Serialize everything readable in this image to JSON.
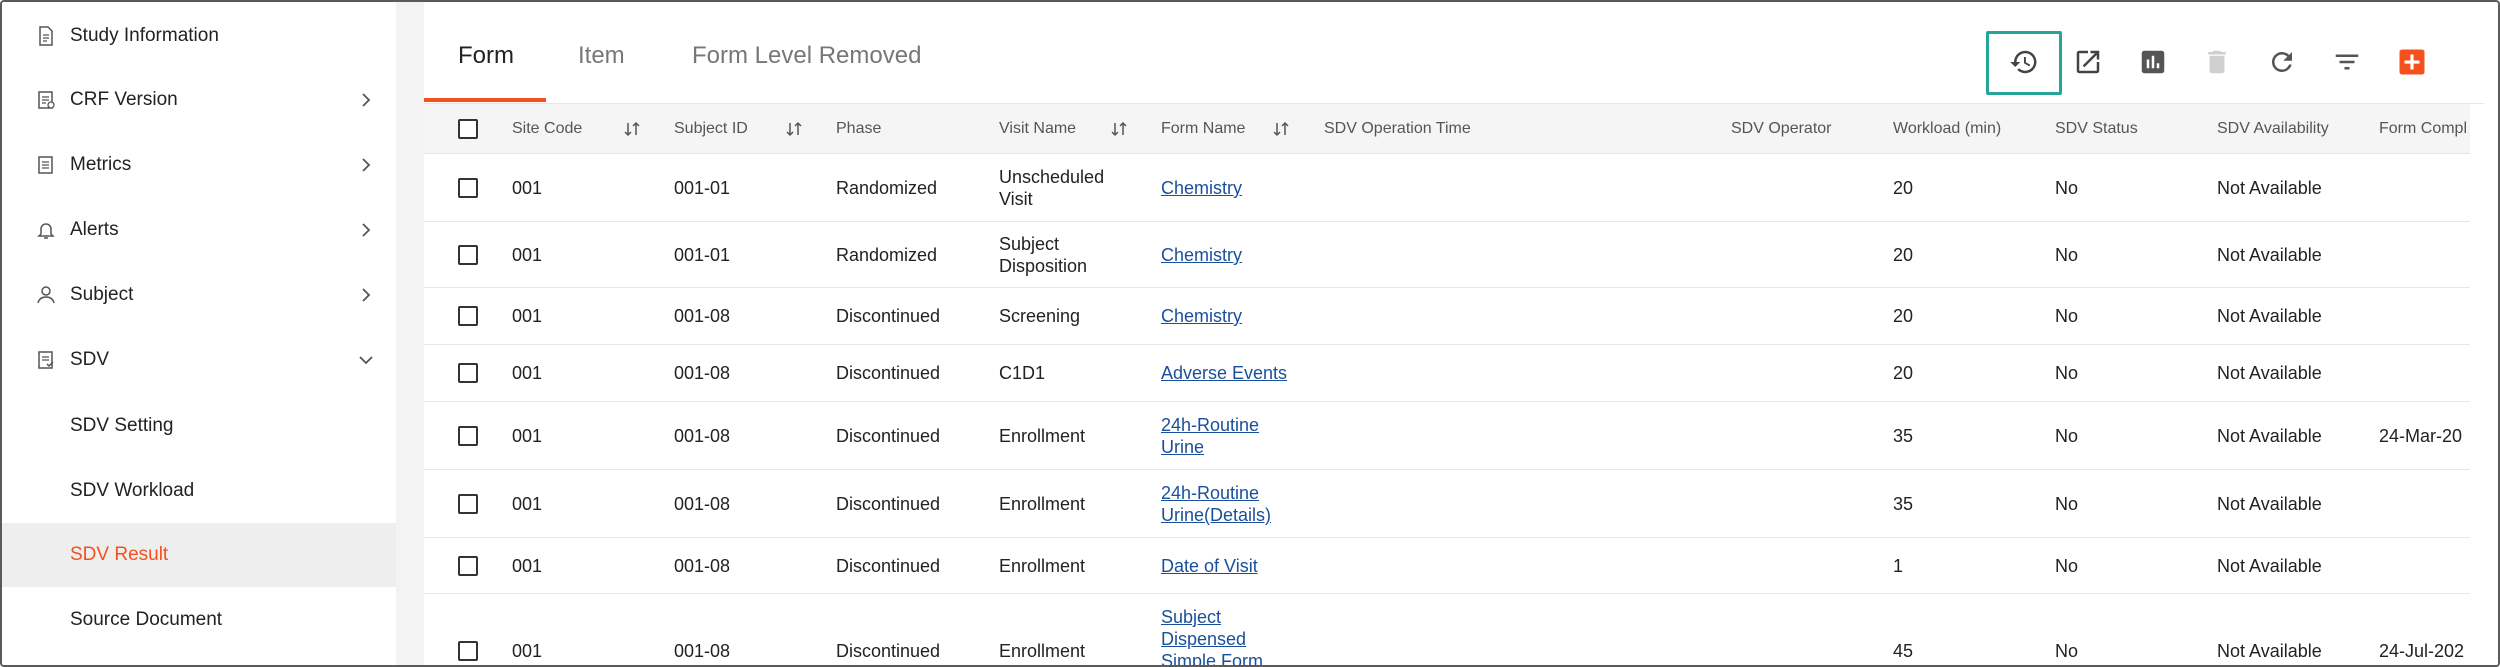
{
  "sidebar": {
    "items": [
      {
        "label": "Study Information",
        "icon": "document-icon",
        "has_chevron": false
      },
      {
        "label": "CRF Version",
        "icon": "form-icon",
        "has_chevron": true
      },
      {
        "label": "Metrics",
        "icon": "metrics-icon",
        "has_chevron": true
      },
      {
        "label": "Alerts",
        "icon": "bell-icon",
        "has_chevron": true
      },
      {
        "label": "Subject",
        "icon": "person-icon",
        "has_chevron": true
      },
      {
        "label": "SDV",
        "icon": "checklist-icon",
        "has_chevron": true,
        "expanded": true
      }
    ],
    "sub_items": [
      {
        "label": "SDV Setting"
      },
      {
        "label": "SDV Workload"
      },
      {
        "label": "SDV Result",
        "active": true
      },
      {
        "label": "Source Document"
      }
    ]
  },
  "tabs": [
    {
      "label": "Form",
      "active": true
    },
    {
      "label": "Item"
    },
    {
      "label": "Form Level Removed"
    }
  ],
  "toolbar": {
    "icons": [
      "history-icon",
      "open-external-icon",
      "bar-chart-icon",
      "delete-icon",
      "refresh-icon",
      "filter-icon",
      "add-icon"
    ],
    "highlighted": "history-icon"
  },
  "table": {
    "headers": [
      "Site Code",
      "Subject ID",
      "Phase",
      "Visit Name",
      "Form Name",
      "SDV Operation Time",
      "SDV Operator",
      "Workload (min)",
      "SDV Status",
      "SDV Availability",
      "Form Compl"
    ],
    "rows": [
      {
        "site": "001",
        "subject": "001-01",
        "phase": "Randomized",
        "visit": "Unscheduled Visit",
        "form": "Chemistry",
        "op_time": "",
        "operator": "",
        "workload": "20",
        "status": "No",
        "availability": "Not Available",
        "form_compl": ""
      },
      {
        "site": "001",
        "subject": "001-01",
        "phase": "Randomized",
        "visit": "Subject Disposition",
        "form": "Chemistry",
        "op_time": "",
        "operator": "",
        "workload": "20",
        "status": "No",
        "availability": "Not Available",
        "form_compl": ""
      },
      {
        "site": "001",
        "subject": "001-08",
        "phase": "Discontinued",
        "visit": "Screening",
        "form": "Chemistry",
        "op_time": "",
        "operator": "",
        "workload": "20",
        "status": "No",
        "availability": "Not Available",
        "form_compl": ""
      },
      {
        "site": "001",
        "subject": "001-08",
        "phase": "Discontinued",
        "visit": "C1D1",
        "form": "Adverse Events",
        "op_time": "",
        "operator": "",
        "workload": "20",
        "status": "No",
        "availability": "Not Available",
        "form_compl": ""
      },
      {
        "site": "001",
        "subject": "001-08",
        "phase": "Discontinued",
        "visit": "Enrollment",
        "form": "24h-Routine Urine",
        "op_time": "",
        "operator": "",
        "workload": "35",
        "status": "No",
        "availability": "Not Available",
        "form_compl": "24-Mar-20"
      },
      {
        "site": "001",
        "subject": "001-08",
        "phase": "Discontinued",
        "visit": "Enrollment",
        "form": "24h-Routine Urine(Details)",
        "op_time": "",
        "operator": "",
        "workload": "35",
        "status": "No",
        "availability": "Not Available",
        "form_compl": ""
      },
      {
        "site": "001",
        "subject": "001-08",
        "phase": "Discontinued",
        "visit": "Enrollment",
        "form": "Date of Visit",
        "op_time": "",
        "operator": "",
        "workload": "1",
        "status": "No",
        "availability": "Not Available",
        "form_compl": ""
      },
      {
        "site": "001",
        "subject": "001-08",
        "phase": "Discontinued",
        "visit": "Enrollment",
        "form": "Subject Dispensed Simple Form",
        "op_time": "",
        "operator": "",
        "workload": "45",
        "status": "No",
        "availability": "Not Available",
        "form_compl": "24-Jul-202"
      }
    ]
  },
  "colors": {
    "accent": "#f4511e",
    "highlight": "#26a69a",
    "link": "#1a4f9c",
    "active_bg": "#eeeeee"
  }
}
